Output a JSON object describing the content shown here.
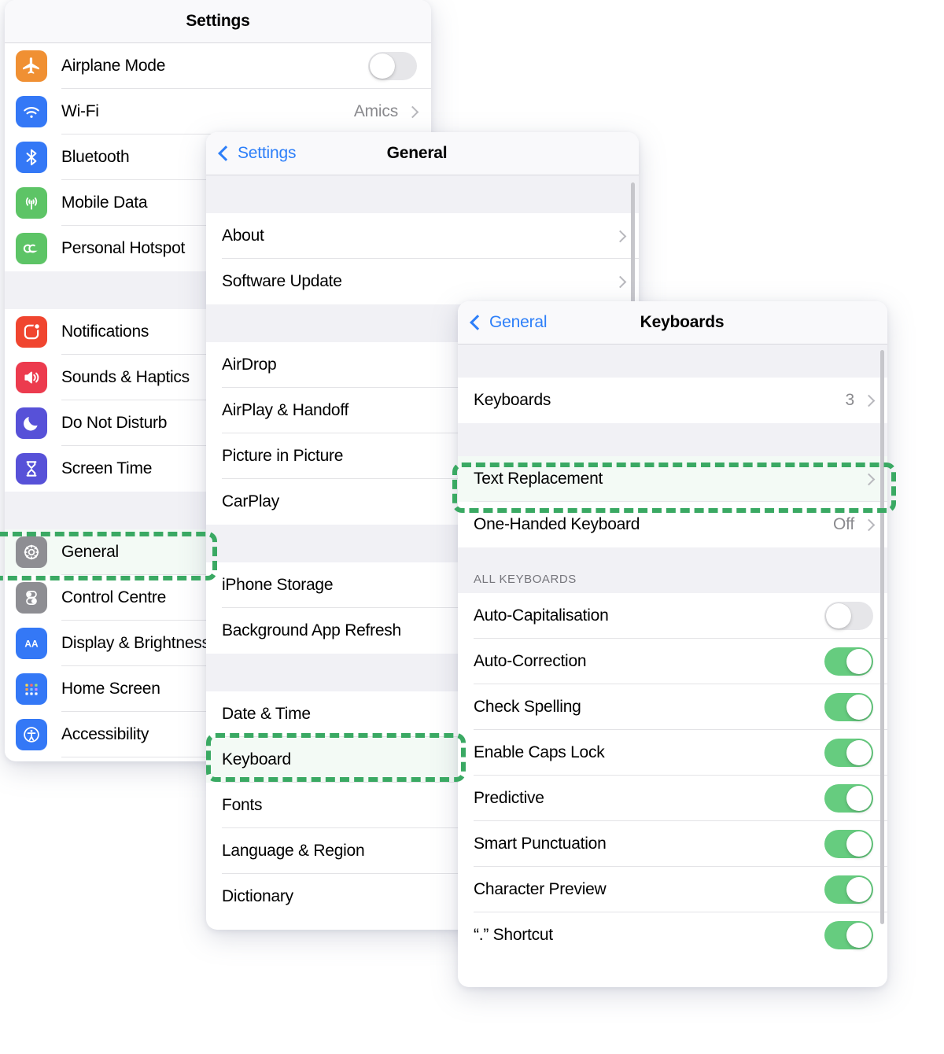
{
  "settings_panel": {
    "title": "Settings",
    "groups": [
      {
        "rows": [
          {
            "label": "Airplane Mode",
            "icon": "airplane-icon",
            "icon_color": "#f09033",
            "control": "toggle",
            "toggle_on": false
          },
          {
            "label": "Wi-Fi",
            "icon": "wifi-icon",
            "icon_color": "#3478f6",
            "control": "value",
            "value": "Amics",
            "chevron": true
          },
          {
            "label": "Bluetooth",
            "icon": "bluetooth-icon",
            "icon_color": "#3478f6",
            "control": "none"
          },
          {
            "label": "Mobile Data",
            "icon": "mobile-data-icon",
            "icon_color": "#5dc466",
            "control": "none"
          },
          {
            "label": "Personal Hotspot",
            "icon": "personal-hotspot-icon",
            "icon_color": "#5dc466",
            "control": "none"
          }
        ]
      },
      {
        "rows": [
          {
            "label": "Notifications",
            "icon": "notifications-icon",
            "icon_color": "#f0452f",
            "control": "none"
          },
          {
            "label": "Sounds & Haptics",
            "icon": "sounds-haptics-icon",
            "icon_color": "#ec3b4e",
            "control": "none"
          },
          {
            "label": "Do Not Disturb",
            "icon": "do-not-disturb-icon",
            "icon_color": "#5751d8",
            "control": "none"
          },
          {
            "label": "Screen Time",
            "icon": "screen-time-icon",
            "icon_color": "#5751d8",
            "control": "none"
          }
        ]
      },
      {
        "rows": [
          {
            "label": "General",
            "icon": "gear-icon",
            "icon_color": "#8e8e93",
            "control": "none",
            "highlighted": true
          },
          {
            "label": "Control Centre",
            "icon": "control-centre-icon",
            "icon_color": "#8e8e93",
            "control": "none"
          },
          {
            "label": "Display & Brightness",
            "icon": "display-brightness-icon",
            "icon_color": "#3478f6",
            "control": "none"
          },
          {
            "label": "Home Screen",
            "icon": "home-screen-icon",
            "icon_color": "#3478f6",
            "control": "none"
          },
          {
            "label": "Accessibility",
            "icon": "accessibility-icon",
            "icon_color": "#3478f6",
            "control": "none"
          }
        ]
      }
    ]
  },
  "general_panel": {
    "back_label": "Settings",
    "title": "General",
    "groups": [
      {
        "rows": [
          {
            "label": "About",
            "chevron": true
          },
          {
            "label": "Software Update",
            "chevron": true
          }
        ]
      },
      {
        "rows": [
          {
            "label": "AirDrop"
          },
          {
            "label": "AirPlay & Handoff"
          },
          {
            "label": "Picture in Picture"
          },
          {
            "label": "CarPlay"
          }
        ]
      },
      {
        "rows": [
          {
            "label": "iPhone Storage"
          },
          {
            "label": "Background App Refresh"
          }
        ]
      },
      {
        "rows": [
          {
            "label": "Date & Time"
          },
          {
            "label": "Keyboard",
            "highlighted": true
          },
          {
            "label": "Fonts"
          },
          {
            "label": "Language & Region"
          },
          {
            "label": "Dictionary"
          }
        ]
      }
    ]
  },
  "keyboards_panel": {
    "back_label": "General",
    "title": "Keyboards",
    "groups": [
      {
        "rows": [
          {
            "label": "Keyboards",
            "value": "3",
            "chevron": true
          }
        ]
      },
      {
        "rows": [
          {
            "label": "Text Replacement",
            "chevron": true,
            "highlighted": true
          },
          {
            "label": "One-Handed Keyboard",
            "value": "Off",
            "chevron": true
          }
        ]
      }
    ],
    "section_header": "ALL KEYBOARDS",
    "toggle_rows": [
      {
        "label": "Auto-Capitalisation",
        "toggle_on": false
      },
      {
        "label": "Auto-Correction",
        "toggle_on": true
      },
      {
        "label": "Check Spelling",
        "toggle_on": true
      },
      {
        "label": "Enable Caps Lock",
        "toggle_on": true
      },
      {
        "label": "Predictive",
        "toggle_on": true
      },
      {
        "label": "Smart Punctuation",
        "toggle_on": true
      },
      {
        "label": "Character Preview",
        "toggle_on": true
      },
      {
        "label": "“.” Shortcut",
        "toggle_on": true
      }
    ]
  },
  "colors": {
    "highlight_dash": "#3aa963",
    "highlight_fill": "#f3faf5",
    "accent_blue": "#2d7ff9",
    "toggle_on": "#66cc7f",
    "toggle_off": "#e6e6e9"
  }
}
